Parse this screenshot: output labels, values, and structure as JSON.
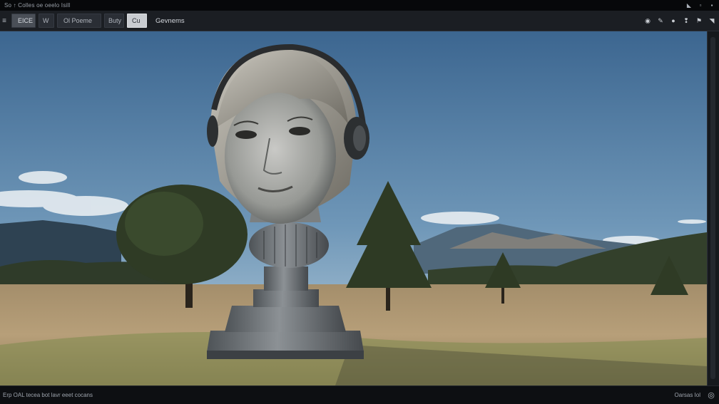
{
  "window": {
    "title": "So ↑ Colles oe oeelo Isill",
    "controls": [
      {
        "name": "minimize-icon",
        "glyph": "◣"
      },
      {
        "name": "restore-icon",
        "glyph": "▫"
      },
      {
        "name": "close-icon",
        "glyph": "▪"
      }
    ]
  },
  "toolbar": {
    "menu_glyph": "≡",
    "buttons": [
      {
        "label": "EICE",
        "state": "selected"
      },
      {
        "label": "W"
      },
      {
        "label": "Ol Poeme"
      },
      {
        "label": "Buty"
      },
      {
        "label": "Cu",
        "state": "active"
      }
    ],
    "label": "Gevnems",
    "icons": [
      {
        "name": "target-icon",
        "glyph": "◉"
      },
      {
        "name": "pen-icon",
        "glyph": "✎"
      },
      {
        "name": "dot-icon",
        "glyph": "●"
      },
      {
        "name": "marker-icon",
        "glyph": "❢"
      },
      {
        "name": "flag-icon",
        "glyph": "⚑"
      },
      {
        "name": "dropdown-icon",
        "glyph": "◥"
      }
    ]
  },
  "viewport": {
    "image_colors": {
      "sky_top": "#3e6790",
      "sky_bottom": "#a8c0d2",
      "grass": "#b49c76",
      "tree": "#2d3a23",
      "statue": "#6f7478"
    }
  },
  "statusbar": {
    "left": "Erp OAL tecea bot  lavr eeet cocans",
    "right": "Oarsas Iol",
    "icon_glyph": "◎"
  }
}
